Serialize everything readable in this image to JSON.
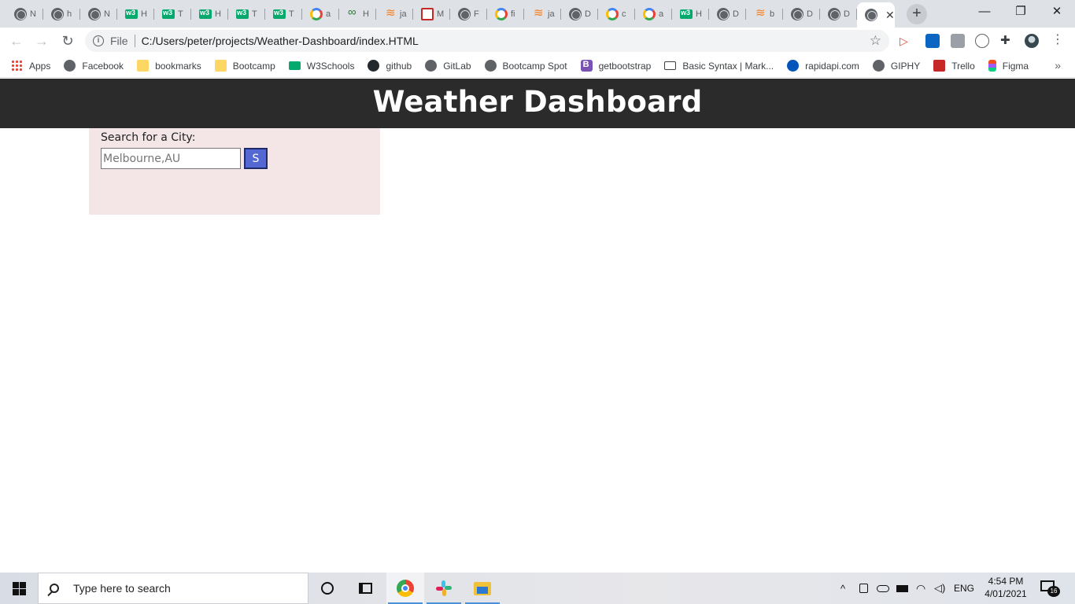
{
  "browser": {
    "tabs": [
      {
        "favicon": "globe-icon",
        "label": "N"
      },
      {
        "favicon": "globe-icon",
        "label": "h"
      },
      {
        "favicon": "globe-icon",
        "label": "N"
      },
      {
        "favicon": "w3schools-icon",
        "label": "H"
      },
      {
        "favicon": "w3schools-icon",
        "label": "T"
      },
      {
        "favicon": "w3schools-icon",
        "label": "H"
      },
      {
        "favicon": "w3schools-icon",
        "label": "T"
      },
      {
        "favicon": "w3schools-icon",
        "label": "T"
      },
      {
        "favicon": "google-icon",
        "label": "a"
      },
      {
        "favicon": "green-link-icon",
        "label": "H"
      },
      {
        "favicon": "stackoverflow-icon",
        "label": "ja"
      },
      {
        "favicon": "mail-icon",
        "label": "M"
      },
      {
        "favicon": "globe-icon",
        "label": "F"
      },
      {
        "favicon": "google-icon",
        "label": "fi"
      },
      {
        "favicon": "stackoverflow-icon",
        "label": "ja"
      },
      {
        "favicon": "globe-icon",
        "label": "D"
      },
      {
        "favicon": "google-icon",
        "label": "c"
      },
      {
        "favicon": "google-icon",
        "label": "a"
      },
      {
        "favicon": "w3schools-icon",
        "label": "H"
      },
      {
        "favicon": "globe-icon",
        "label": "D"
      },
      {
        "favicon": "stackoverflow-icon",
        "label": "b"
      },
      {
        "favicon": "globe-icon",
        "label": "D"
      },
      {
        "favicon": "globe-icon",
        "label": "D"
      }
    ],
    "active_tab": {
      "favicon": "globe-icon",
      "close": "✕"
    },
    "new_tab": "+",
    "window_controls": {
      "minimize": "—",
      "restore": "❐",
      "close": "✕"
    },
    "nav": {
      "back": "←",
      "forward": "→",
      "reload": "↻"
    },
    "address": {
      "scheme_label": "File",
      "url": "C:/Users/peter/projects/Weather-Dashboard/index.HTML",
      "info": "i",
      "star": "☆"
    },
    "extensions": [
      "cast-icon",
      "linkedin-icon",
      "download-icon",
      "code-icon",
      "puzzle-icon",
      "profile-avatar",
      "more-icon"
    ],
    "bookmarks": [
      {
        "label": "Apps",
        "icon": "apps"
      },
      {
        "label": "Facebook",
        "icon": "globe"
      },
      {
        "label": "bookmarks",
        "icon": "folder"
      },
      {
        "label": "Bootcamp",
        "icon": "folder"
      },
      {
        "label": "W3Schools",
        "icon": "w3"
      },
      {
        "label": "github",
        "icon": "gh"
      },
      {
        "label": "GitLab",
        "icon": "globe"
      },
      {
        "label": "Bootcamp Spot",
        "icon": "globe"
      },
      {
        "label": "getbootstrap",
        "icon": "bs"
      },
      {
        "label": "Basic Syntax | Mark...",
        "icon": "md"
      },
      {
        "label": "rapidapi.com",
        "icon": "rapid"
      },
      {
        "label": "GIPHY",
        "icon": "globe"
      },
      {
        "label": "Trello",
        "icon": "trello"
      },
      {
        "label": "Figma",
        "icon": "figma"
      }
    ],
    "bookmarks_more": "»"
  },
  "page": {
    "title": "Weather Dashboard",
    "search": {
      "label": "Search for a City:",
      "placeholder": "Melbourne,AU",
      "button": "S"
    },
    "colors": {
      "header_bg": "#2b2b2b",
      "panel_bg": "#f4e6e6",
      "button_bg": "#5468d4"
    }
  },
  "taskbar": {
    "search_placeholder": "Type here to search",
    "pinned": [
      "cortana-icon",
      "task-view-icon",
      "chrome-icon",
      "slack-icon",
      "file-explorer-icon"
    ],
    "tray": {
      "chevron": "^",
      "language": "ENG"
    },
    "clock": {
      "time": "4:54 PM",
      "date": "4/01/2021"
    },
    "notifications": "16"
  }
}
